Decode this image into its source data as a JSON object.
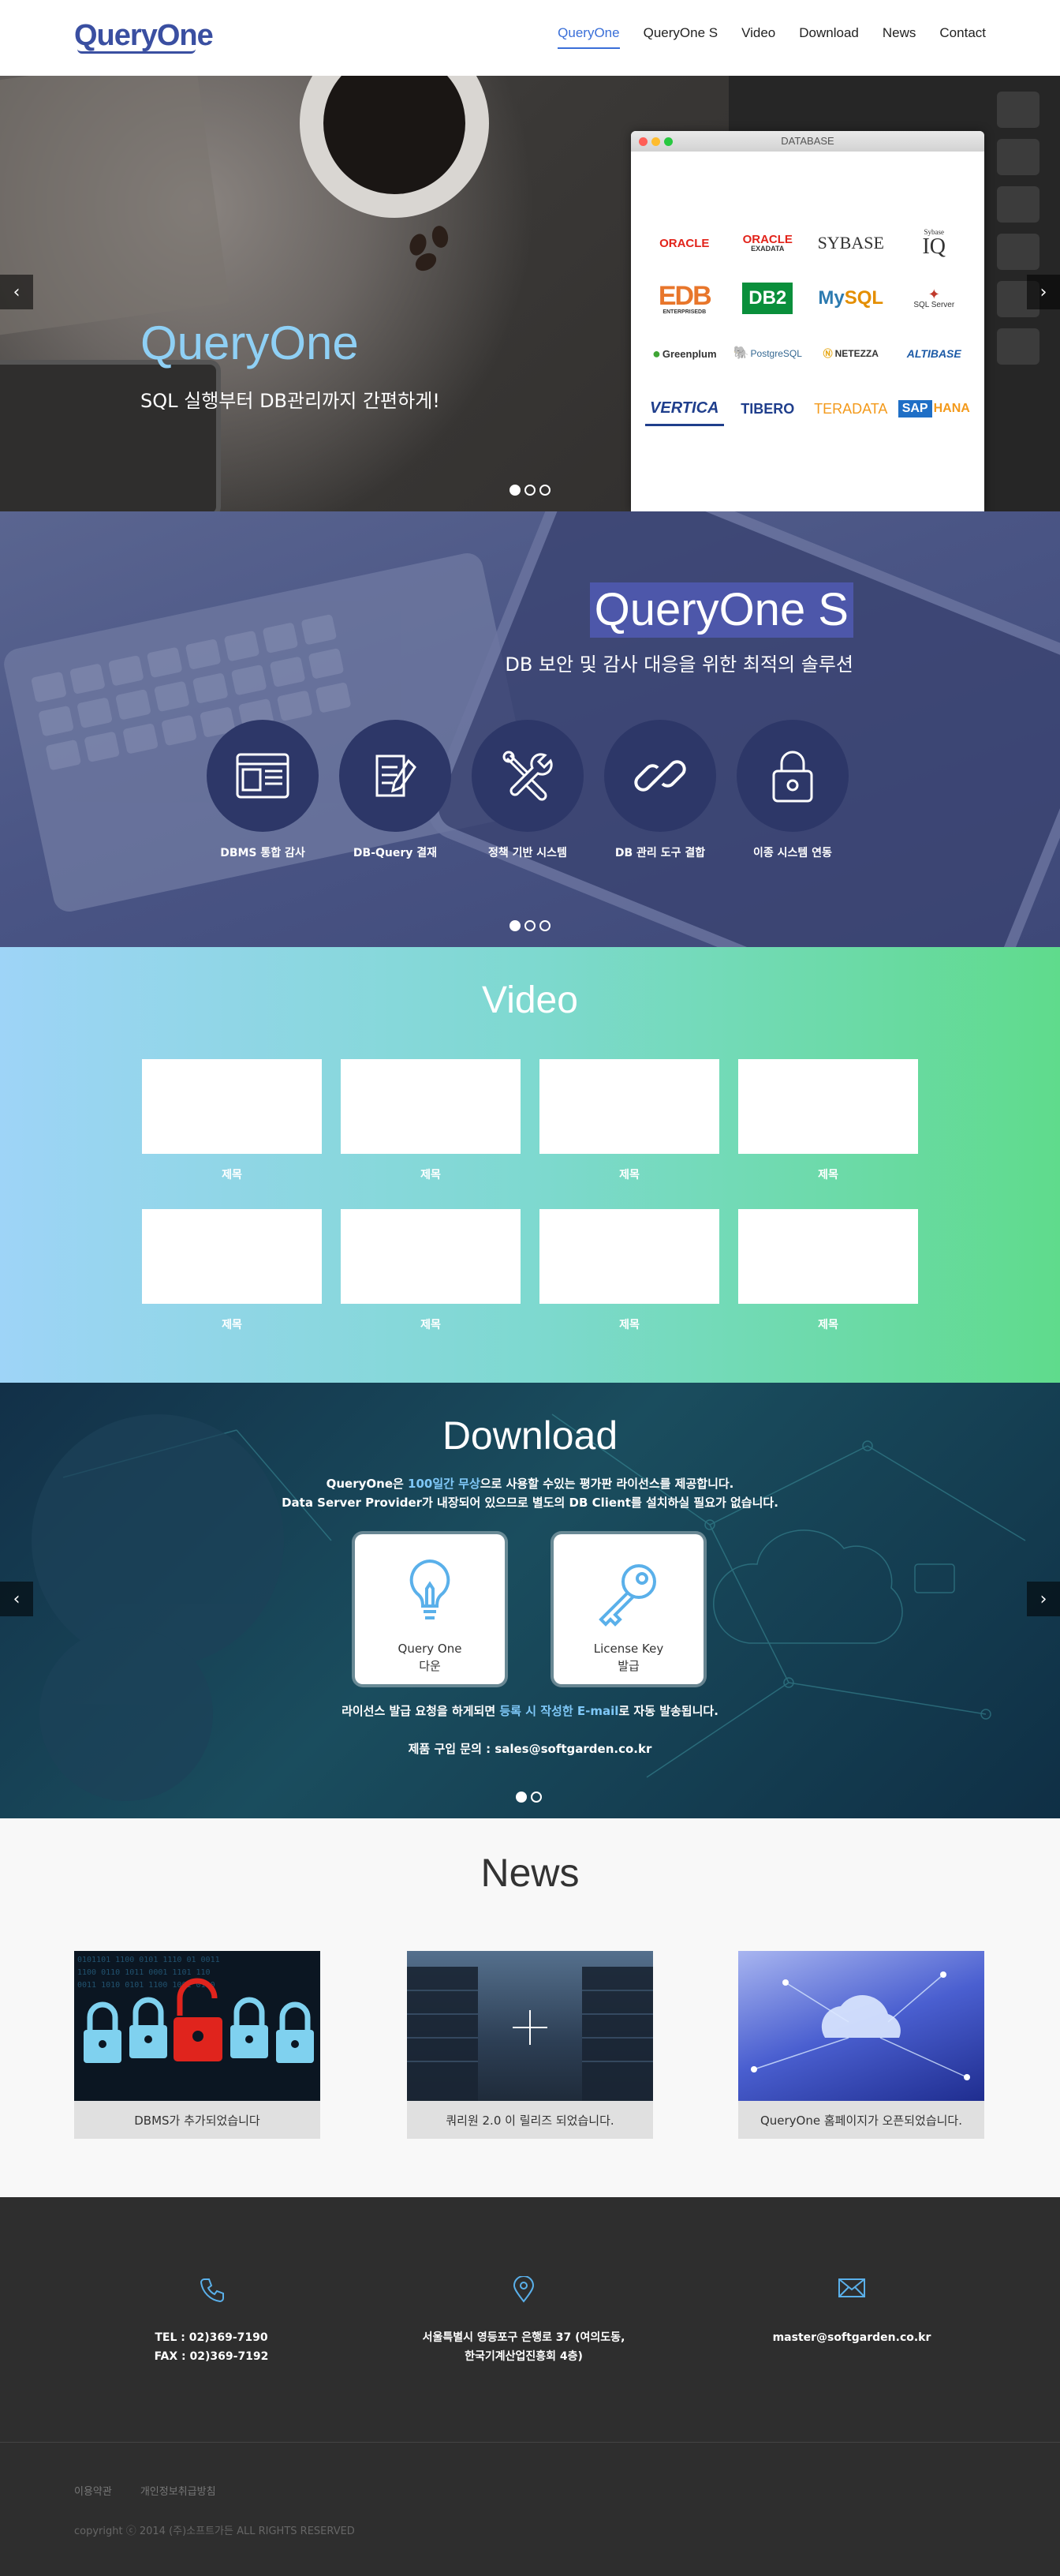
{
  "header": {
    "logo_text": "QueryOne",
    "nav": [
      {
        "label": "QueryOne",
        "active": true
      },
      {
        "label": "QueryOne S",
        "active": false
      },
      {
        "label": "Video",
        "active": false
      },
      {
        "label": "Download",
        "active": false
      },
      {
        "label": "News",
        "active": false
      },
      {
        "label": "Contact",
        "active": false
      }
    ]
  },
  "hero1": {
    "title": "QueryOne",
    "subtitle": "SQL 실행부터 DB관리까지 간편하게!",
    "prev_icon": "chevron-left-icon",
    "next_icon": "chevron-right-icon",
    "slide_count": 3,
    "active_slide": 1,
    "db_window": {
      "title": "DATABASE",
      "logos": [
        "ORACLE",
        "ORACLE EXADATA",
        "SYBASE",
        "Sybase IQ",
        "EDB ENTERPRISEDB",
        "DB2",
        "MySQL",
        "SQL Server",
        "Greenplum",
        "PostgreSQL",
        "NETEZZA",
        "ALTIBASE",
        "VERTICA",
        "TIBERO",
        "TERADATA",
        "SAP HANA"
      ]
    }
  },
  "hero2": {
    "title": "QueryOne S",
    "subtitle": "DB 보안 및 감사 대응을 위한 최적의 솔루션",
    "features": [
      {
        "label": "DBMS 통합 감사",
        "icon": "browser-window-icon"
      },
      {
        "label": "DB-Query 결재",
        "icon": "document-edit-icon"
      },
      {
        "label": "정책 기반 시스템",
        "icon": "tools-icon"
      },
      {
        "label": "DB 관리 도구 결합",
        "icon": "link-icon"
      },
      {
        "label": "이종 시스템 연동",
        "icon": "lock-icon"
      }
    ],
    "slide_count": 3,
    "active_slide": 1
  },
  "video": {
    "title": "Video",
    "items": [
      "제목",
      "제목",
      "제목",
      "제목",
      "제목",
      "제목",
      "제목",
      "제목"
    ]
  },
  "download": {
    "title": "Download",
    "line1_pre": "QueryOne은 ",
    "line1_hl": "100일간 무상",
    "line1_post": "으로 사용할 수있는 평가판 라이선스를 제공합니다.",
    "line2": "Data Server Provider가 내장되어 있으므로 별도의 DB Client를 설치하실 필요가 없습니다.",
    "card1": {
      "line1": "Query One",
      "line2": "다운",
      "icon": "lightbulb-icon"
    },
    "card2": {
      "line1": "License Key",
      "line2": "발급",
      "icon": "key-icon"
    },
    "notice_pre": "라이선스 발급 요청을 하게되면 ",
    "notice_hl": "등록 시 작성한 E-mail",
    "notice_post": "로 자동 발송됩니다.",
    "contact": "제품 구입 문의 : sales@softgarden.co.kr",
    "slide_count": 2,
    "active_slide": 1
  },
  "news": {
    "title": "News",
    "items": [
      {
        "caption": "DBMS가 추가되었습니다"
      },
      {
        "caption": "쿼리원 2.0 이 릴리즈 되었습니다."
      },
      {
        "caption": "QueryOne 홈페이지가 오픈되었습니다."
      }
    ]
  },
  "footer": {
    "phone": {
      "icon": "phone-icon",
      "line1": "TEL : 02)369-7190",
      "line2": "FAX : 02)369-7192"
    },
    "address": {
      "icon": "map-pin-icon",
      "line1": "서울특별시 영등포구 은행로 37 (여의도동,",
      "line2": "한국기계산업진흥회 4층)"
    },
    "email": {
      "icon": "envelope-icon",
      "line1": "master@softgarden.co.kr"
    },
    "links": [
      "이용약관",
      "개인정보취급방침"
    ],
    "copyright": "copyright ⓒ 2014 (주)소프트가든 ALL RIGHTS RESERVED"
  },
  "colors": {
    "brand": "#3a4fa1",
    "nav_active": "#3a6fd8",
    "hero_title": "#8fd0f5",
    "feature_circle": "#2d3768",
    "footer_bg": "#2e2e2e"
  }
}
